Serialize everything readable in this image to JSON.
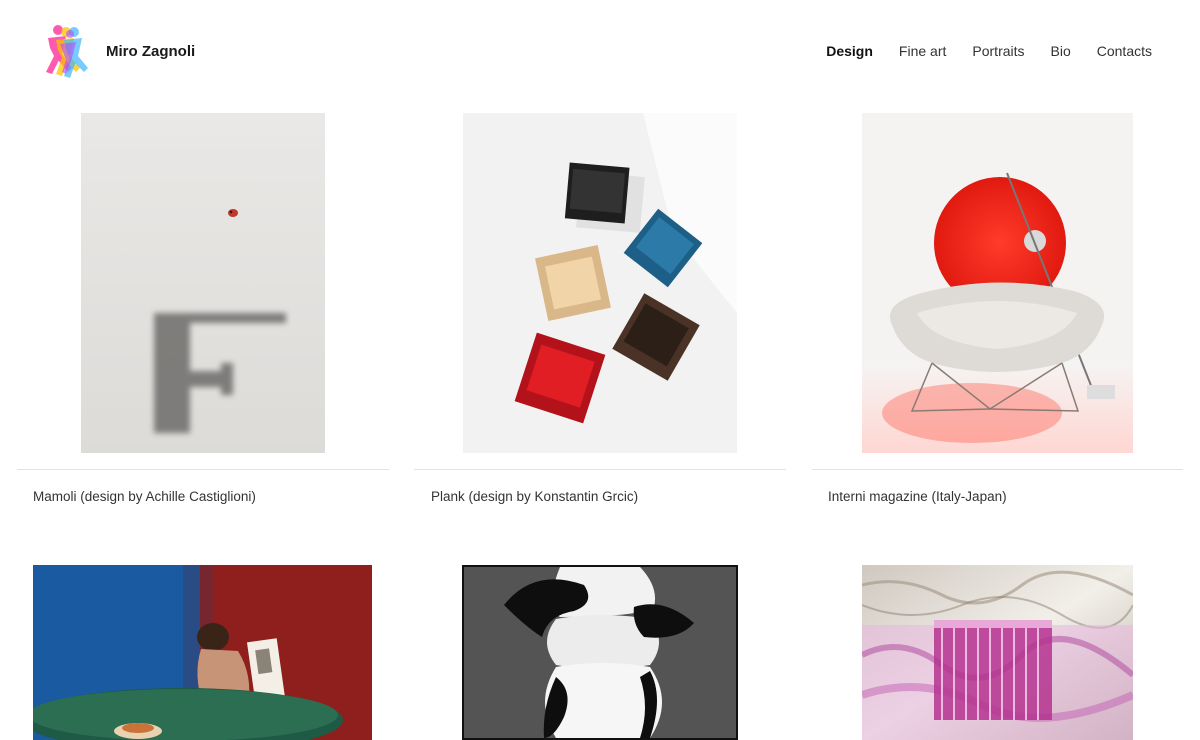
{
  "header": {
    "brand": "Miro Zagnoli",
    "nav": [
      {
        "label": "Design",
        "active": true
      },
      {
        "label": "Fine art",
        "active": false
      },
      {
        "label": "Portraits",
        "active": false
      },
      {
        "label": "Bio",
        "active": false
      },
      {
        "label": "Contacts",
        "active": false
      }
    ]
  },
  "gallery": {
    "items": [
      {
        "caption": "Mamoli (design by Achille Castiglioni)",
        "image": "faucet-shadow-ladybug"
      },
      {
        "caption": "Plank (design by Konstantin Grcic)",
        "image": "colored-chairs-top-view"
      },
      {
        "caption": "Interni magazine (Italy-Japan)",
        "image": "red-lamp-white-armchair"
      },
      {
        "caption": "",
        "image": "woman-reading-table"
      },
      {
        "caption": "",
        "image": "white-lamp-black-silhouette"
      },
      {
        "caption": "",
        "image": "pink-chandelier-marble"
      }
    ]
  },
  "colors": {
    "nav_text": "#333333",
    "divider": "#e3e3e3",
    "background": "#ffffff"
  }
}
